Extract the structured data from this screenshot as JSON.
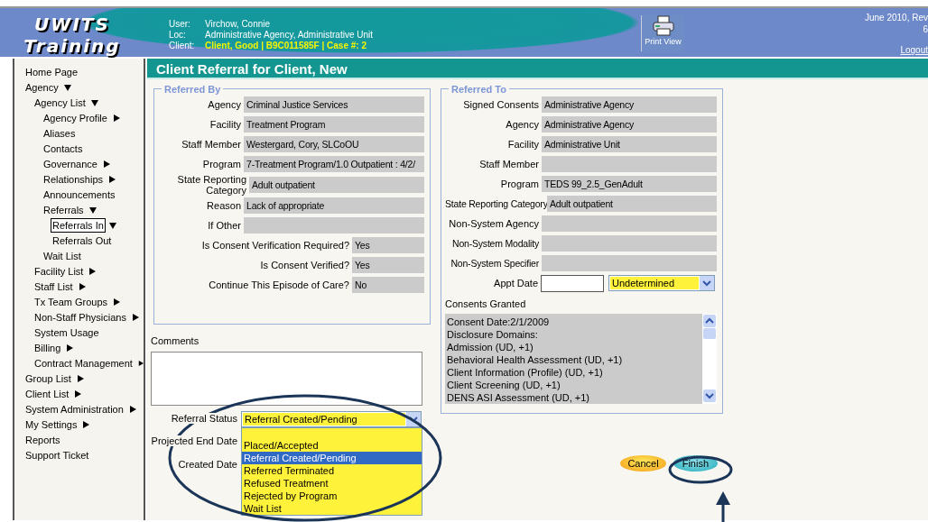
{
  "header": {
    "logo_line1": "UWITS",
    "logo_line2": "Training",
    "info": [
      {
        "label": "User:",
        "value": "Virchow, Connie",
        "kind": "plain"
      },
      {
        "label": "Loc:",
        "value": "Administrative Agency, Administrative Unit",
        "kind": "plain"
      },
      {
        "label": "Client:",
        "value": "Client, Good | B9C011585F | Case #: 2",
        "kind": "highlight"
      }
    ],
    "print_label": "Print View",
    "version": "June 2010, Rev",
    "version_2": "6",
    "logout": "Logout"
  },
  "sidebar": {
    "items": [
      {
        "label": "Home Page",
        "selected": false
      },
      {
        "label": "Agency",
        "expanded": true,
        "selected": false,
        "children": [
          {
            "label": "Agency List",
            "expanded": true,
            "selected": false,
            "children": [
              {
                "label": "Agency Profile",
                "expanded": false,
                "selected": false
              },
              {
                "label": "Aliases",
                "selected": false
              },
              {
                "label": "Contacts",
                "selected": false
              },
              {
                "label": "Governance",
                "expanded": false,
                "selected": false
              },
              {
                "label": "Relationships",
                "expanded": false,
                "selected": false
              },
              {
                "label": "Announcements",
                "selected": false
              },
              {
                "label": "Referrals",
                "expanded": true,
                "selected": false,
                "children": [
                  {
                    "label": "Referrals In",
                    "expanded": true,
                    "selected": true
                  },
                  {
                    "label": "Referrals Out",
                    "selected": false
                  }
                ]
              },
              {
                "label": "Wait List",
                "selected": false
              }
            ]
          },
          {
            "label": "Facility List",
            "expanded": false,
            "selected": false
          },
          {
            "label": "Staff List",
            "expanded": false,
            "selected": false
          },
          {
            "label": "Tx Team Groups",
            "expanded": false,
            "selected": false
          },
          {
            "label": "Non-Staff Physicians",
            "expanded": false,
            "selected": false
          },
          {
            "label": "System Usage",
            "selected": false
          },
          {
            "label": "Billing",
            "expanded": false,
            "selected": false
          },
          {
            "label": "Contract Management",
            "expanded": false,
            "selected": false
          }
        ]
      },
      {
        "label": "Group List",
        "expanded": false,
        "selected": false
      },
      {
        "label": "Client List",
        "expanded": false,
        "selected": false
      },
      {
        "label": "System Administration",
        "expanded": false,
        "selected": false
      },
      {
        "label": "My Settings",
        "expanded": false,
        "selected": false
      },
      {
        "label": "Reports",
        "selected": false
      },
      {
        "label": "Support Ticket",
        "selected": false
      }
    ]
  },
  "page_title": "Client Referral for Client, New",
  "referred_by": {
    "legend": "Referred By",
    "fields": [
      {
        "label": "Agency",
        "value": "Criminal Justice Services",
        "kind": "wide"
      },
      {
        "label": "Facility",
        "value": "Treatment Program",
        "kind": "wide"
      },
      {
        "label": "Staff Member",
        "value": "Westergard, Cory, SLCoOU",
        "kind": "wide"
      },
      {
        "label": "Program",
        "value": "7-Treatment Program/1.0 Outpatient : 4/2/",
        "kind": "wide"
      },
      {
        "label": "State Reporting Category",
        "value": "Adult outpatient",
        "kind": "wide"
      },
      {
        "label": "Reason",
        "value": "Lack of appropriate",
        "kind": "wide"
      },
      {
        "label": "If Other",
        "kind": "wide"
      },
      {
        "label": "Is Consent Verification Required?",
        "value": "Yes",
        "kind": "short"
      },
      {
        "label": "Is Consent Verified?",
        "value": "Yes",
        "kind": "short"
      },
      {
        "label": "Continue This Episode of Care?",
        "value": "No",
        "kind": "short"
      }
    ]
  },
  "referred_to": {
    "legend": "Referred To",
    "fields": [
      {
        "label": "Signed Consents",
        "value": "Administrative Agency"
      },
      {
        "label": "Agency",
        "value": "Administrative Agency"
      },
      {
        "label": "Facility",
        "value": "Administrative Unit"
      },
      {
        "label": "Staff Member"
      },
      {
        "label": "Program",
        "value": "TEDS 99_2.5_GenAdult"
      },
      {
        "label": "State Reporting Category",
        "value": "Adult outpatient"
      },
      {
        "label": "Non-System Agency"
      },
      {
        "label": "Non-System Modality"
      },
      {
        "label": "Non-System Specifier"
      }
    ],
    "appt_date": {
      "label": "Appt Date",
      "select": "Undetermined"
    },
    "consents": {
      "label": "Consents Granted",
      "lines": [
        "Consent Date:2/1/2009",
        "Disclosure Domains:",
        "Admission (UD, +1)",
        "Behavioral Health Assessment (UD, +1)",
        "Client Information (Profile) (UD, +1)",
        "Client Screening (UD, +1)",
        "DENS ASI Assessment (UD, +1)"
      ]
    }
  },
  "comments": {
    "label": "Comments"
  },
  "referral_status": {
    "label": "Referral Status",
    "value": "Referral Created/Pending",
    "expanded": true,
    "options": [
      {
        "label": "Placed/Accepted",
        "selected": false
      },
      {
        "label": "Referral Created/Pending",
        "selected": true
      },
      {
        "label": "Referred Terminated",
        "selected": false
      },
      {
        "label": "Refused Treatment",
        "selected": false
      },
      {
        "label": "Rejected by Program",
        "selected": false
      },
      {
        "label": "Wait List",
        "selected": false
      }
    ]
  },
  "projected_end_date": {
    "label": "Projected End Date"
  },
  "created_date": {
    "label": "Created Date"
  },
  "buttons": {
    "cancel": "Cancel",
    "finish": "Finish"
  }
}
